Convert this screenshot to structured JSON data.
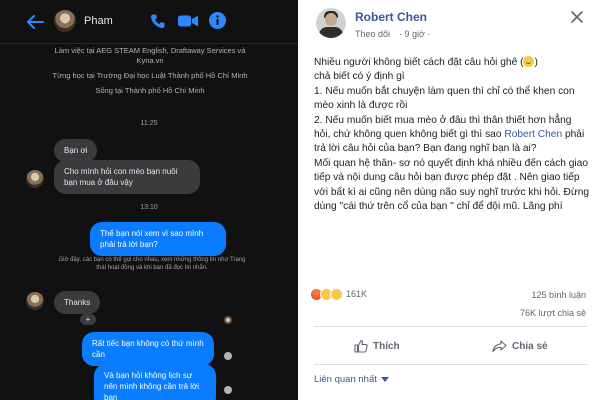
{
  "messenger": {
    "contact_name": "Pham",
    "profile_lines": [
      "Làm việc tại AEG STEAM English, Draftaway Services và Kyna.vn",
      "Từng học tại Trường Đại học Luật Thành phố Hồ Chí Minh",
      "Sống tại Thành phố Hồ Chí Minh"
    ],
    "time_1": "11:25",
    "msg_1": "Bạn ơi",
    "msg_2": "Cho mình hỏi con mèo bạn nuôi bạn mua ở đâu vậy",
    "time_2": "13:10",
    "msg_3": "Thế bạn nói xem vì sao mình phải trả lời bạn?",
    "notice": "Giờ đây, các bạn có thể gọi cho nhau, xem những thông tin như Trạng thái hoạt động và khi bạn đã đọc tin nhắn.",
    "msg_4": "Thanks",
    "reaction_badge": "+",
    "msg_5": "Rất tiếc bạn không có thứ mình cần",
    "msg_6": "Và bạn hỏi không lịch sự nên mình không cần trả lời bạn",
    "colors": {
      "background": "#111111",
      "bubble_gray": "#3a3b3c",
      "bubble_blue": "#0a7cff",
      "icon_blue": "#2d88ff"
    }
  },
  "post": {
    "author": "Robert Chen",
    "follow_label": "Theo dõi",
    "time_label": "· 9 giờ ·",
    "body_line_1": "Nhiều người không biết cách đặt câu hỏi ghê",
    "body_line_2": "chả biết có ý định gì",
    "body_line_3": "1. Nếu muốn bắt chuyện làm quen thì chỉ có thể khen con mèo xinh là được rồi",
    "body_line_4a": "2. Nếu muốn biết mua mèo ở đâu thì thân thiết hơn hẳng hỏi, chứ không quen không biết gì thì sao",
    "body_mention": "Robert Chen",
    "body_line_4b": "phải trả lời câu hỏi của bạn? Bạn đang nghĩ bạn là ai?",
    "body_line_5": "Mối quan hệ thân- sơ nó quyết định khá nhiều đến cách giao tiếp và nội dung câu hỏi bạn được phép đặt . Nên giao tiếp với bất kì ai cũng nên dùng não suy nghĩ trước khi hỏi. Đừng dùng \"cái thứ trên cổ của bạn \" chỉ để đội mũ. Lãng phí",
    "reaction_count": "161K",
    "comments_label": "125 bình luận",
    "shares_label": "76K lượt chia sẻ",
    "like_label": "Thích",
    "share_label": "Chia sẻ",
    "related_label": "Liên quan nhất",
    "colors": {
      "link": "#385898",
      "text": "#1c1e21",
      "meta": "#606770"
    },
    "icons": [
      "close-icon",
      "smile-emoji-icon",
      "angry-reaction-icon",
      "haha-reaction-icon",
      "wow-reaction-icon",
      "like-icon",
      "share-icon",
      "caret-down-icon"
    ]
  }
}
